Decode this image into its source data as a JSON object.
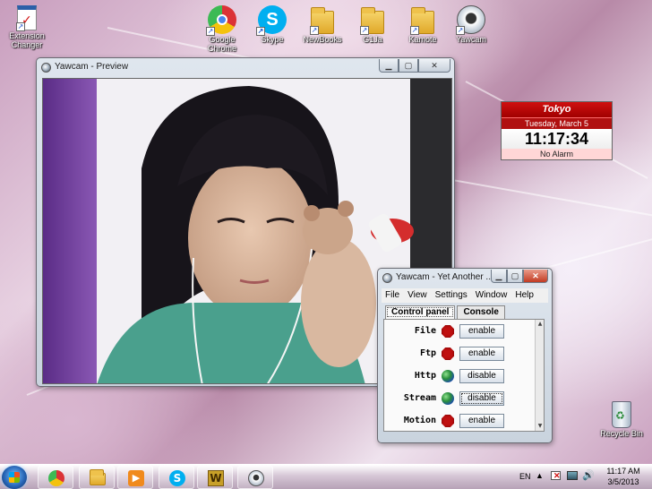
{
  "desktop": {
    "icons": [
      {
        "label_lines": [
          "Extension",
          "Changer"
        ],
        "icon": "checklist-icon"
      },
      {
        "label_lines": [
          "Google",
          "Chrome"
        ],
        "icon": "chrome-icon"
      },
      {
        "label_lines": [
          "Skype"
        ],
        "icon": "skype-icon"
      },
      {
        "label_lines": [
          "NewBooks"
        ],
        "icon": "folder-icon"
      },
      {
        "label_lines": [
          "G1Ja"
        ],
        "icon": "folder-icon"
      },
      {
        "label_lines": [
          "Kamote"
        ],
        "icon": "folder-icon"
      },
      {
        "label_lines": [
          "Yawcam"
        ],
        "icon": "webcam-icon"
      },
      {
        "label_lines": [
          "Recycle Bin"
        ],
        "icon": "recycle-bin-icon"
      }
    ]
  },
  "preview_window": {
    "title": "Yawcam - Preview"
  },
  "control_window": {
    "title": "Yawcam - Yet Another ...",
    "menu": [
      "File",
      "View",
      "Settings",
      "Window",
      "Help"
    ],
    "tabs": [
      "Control panel",
      "Console"
    ],
    "rows": [
      {
        "label": "File",
        "status": "stopped",
        "button": "enable"
      },
      {
        "label": "Ftp",
        "status": "stopped",
        "button": "enable"
      },
      {
        "label": "Http",
        "status": "running",
        "button": "disable"
      },
      {
        "label": "Stream",
        "status": "running",
        "button": "disable"
      },
      {
        "label": "Motion",
        "status": "stopped",
        "button": "enable"
      }
    ]
  },
  "clock_gadget": {
    "city": "Tokyo",
    "date": "Tuesday, March 5",
    "time": "11:17:34",
    "alarm": "No Alarm"
  },
  "taskbar": {
    "language": "EN",
    "time": "11:17 AM",
    "date": "3/5/2013",
    "apps": [
      "chrome-icon",
      "explorer-icon",
      "media-player-icon",
      "skype-icon",
      "winword-icon",
      "yawcam-icon"
    ]
  },
  "colors": {
    "stopped": "#c01010",
    "running": "#2a8f3a",
    "clock_red": "#b01010"
  }
}
